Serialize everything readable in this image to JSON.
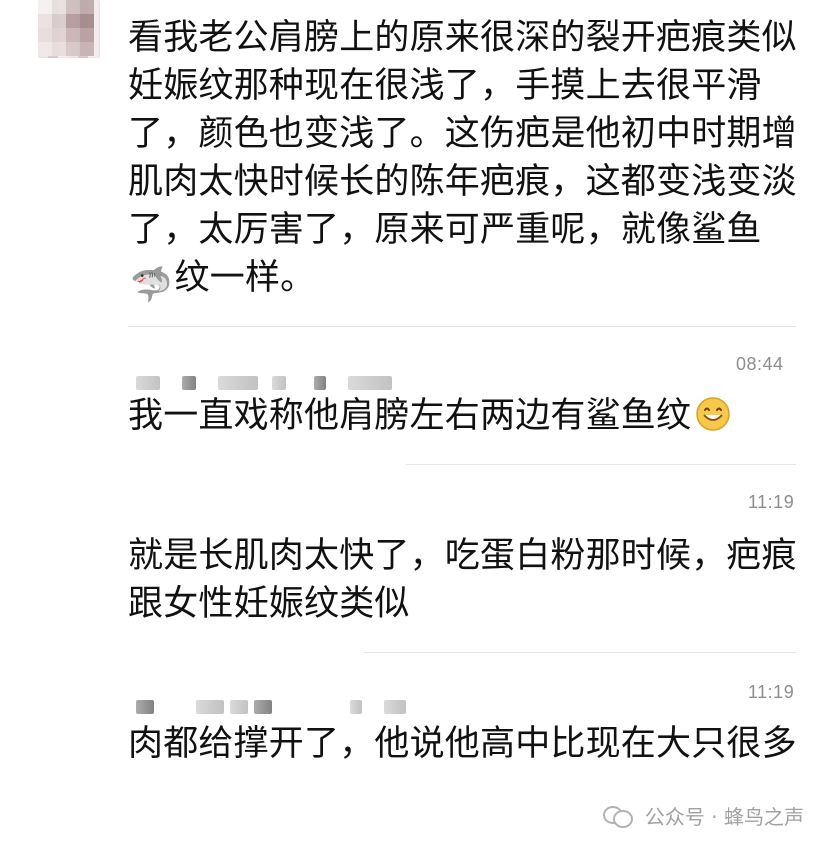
{
  "messages": [
    {
      "text_before_emoji": "看我老公肩膀上的原来很深的裂开疤痕类似妊娠纹那种现在很浅了，手摸上去很平滑了，颜色也变浅了。这伤疤是他初中时期增肌肉太快时候长的陈年疤痕，这都变浅变淡了，太厉害了，原来可严重呢，就像鲨鱼",
      "emoji": "🦈",
      "text_after_emoji": "纹一样。"
    },
    {
      "time": "08:44",
      "text": "我一直戏称他肩膀左右两边有鲨鱼纹"
    },
    {
      "time": "11:19",
      "text": "就是长肌肉太快了，吃蛋白粉那时候，疤痕跟女性妊娠纹类似"
    },
    {
      "time": "11:19",
      "text": "肉都给撑开了，他说他高中比现在大只很多"
    }
  ],
  "watermark": {
    "label": "公众号 · 蜂鸟之声"
  },
  "icons": {
    "smile": "smile-emoji-icon",
    "shark": "shark-emoji-icon",
    "wechat": "wechat-icon"
  }
}
